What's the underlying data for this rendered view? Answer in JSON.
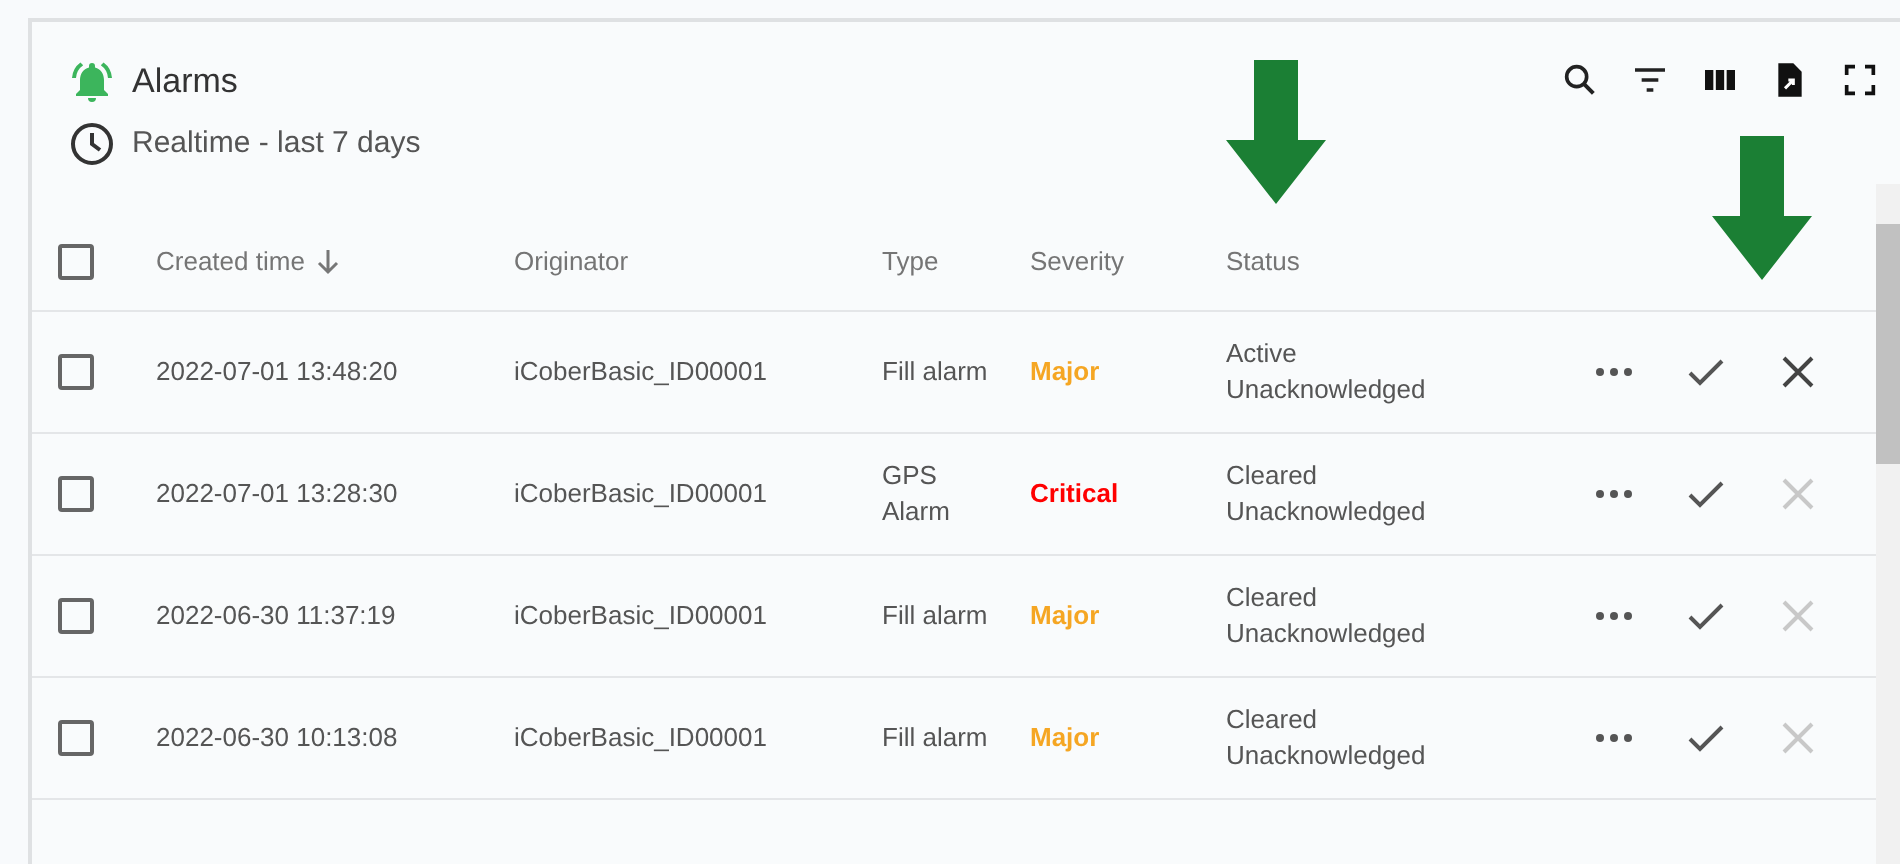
{
  "card": {
    "title": "Alarms",
    "subtitle": "Realtime - last 7 days"
  },
  "table": {
    "select_all_checked": false,
    "columns": [
      {
        "label": "Created time",
        "sorted": true
      },
      {
        "label": "Originator",
        "sorted": false
      },
      {
        "label": "Type",
        "sorted": false
      },
      {
        "label": "Severity",
        "sorted": false
      },
      {
        "label": "Status",
        "sorted": false
      }
    ],
    "rows": [
      {
        "created_time": "2022-07-01 13:48:20",
        "originator": "iCoberBasic_ID00001",
        "type": "Fill alarm",
        "severity": "Major",
        "color": "#f5a623",
        "status": [
          "Active",
          "Unacknowledged"
        ],
        "clear_disabled": false,
        "checked": false
      },
      {
        "created_time": "2022-07-01 13:28:30",
        "originator": "iCoberBasic_ID00001",
        "type": "GPS Alarm",
        "severity": "Critical",
        "color": "#ff0000",
        "status": [
          "Cleared",
          "Unacknowledged"
        ],
        "clear_disabled": true,
        "checked": false
      },
      {
        "created_time": "2022-06-30 11:37:19",
        "originator": "iCoberBasic_ID00001",
        "type": "Fill alarm",
        "severity": "Major",
        "color": "#f5a623",
        "status": [
          "Cleared",
          "Unacknowledged"
        ],
        "clear_disabled": true,
        "checked": false
      },
      {
        "created_time": "2022-06-30 10:13:08",
        "originator": "iCoberBasic_ID00001",
        "type": "Fill alarm",
        "severity": "Major",
        "color": "#f5a623",
        "status": [
          "Cleared",
          "Unacknowledged"
        ],
        "clear_disabled": true,
        "checked": false
      }
    ]
  }
}
